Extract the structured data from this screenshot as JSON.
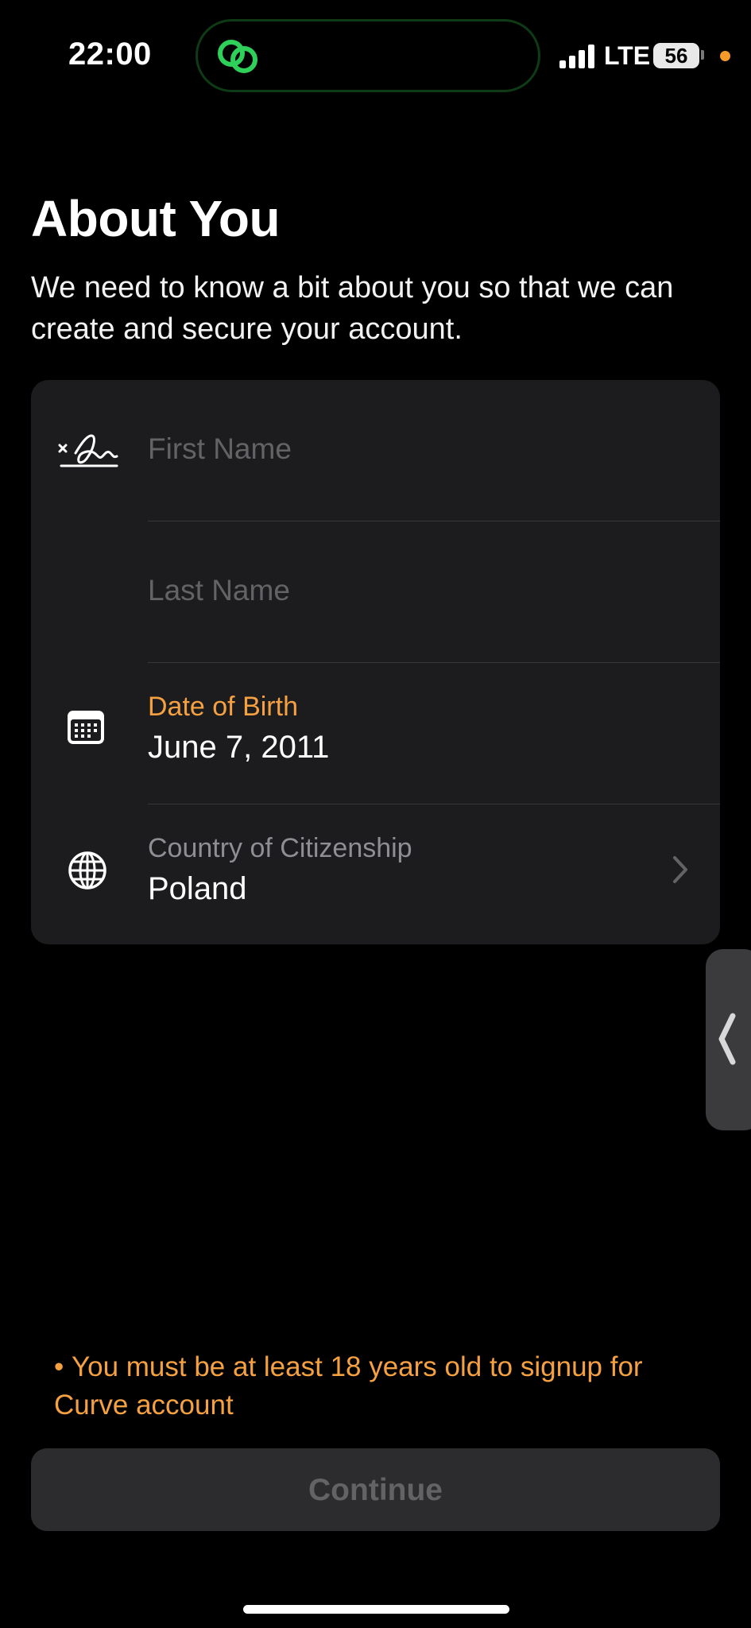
{
  "status_bar": {
    "time": "22:00",
    "network": "LTE",
    "battery": "56",
    "dynamic_island_icon": "linked-rings-icon",
    "accent_green": "#2fd05a",
    "privacy_dot": "#f39a2b"
  },
  "header": {
    "title": "About You",
    "subtitle": "We need to know a bit about you so that we can create and secure your account."
  },
  "form": {
    "first_name": {
      "placeholder": "First Name",
      "icon": "signature-icon"
    },
    "last_name": {
      "placeholder": "Last Name"
    },
    "date_of_birth": {
      "label": "Date of Birth",
      "value": "June 7, 2011",
      "icon": "calendar-icon",
      "label_color": "#f5a142"
    },
    "citizenship": {
      "label": "Country of Citizenship",
      "value": "Poland",
      "icon": "globe-icon"
    }
  },
  "warning": {
    "text": "You must be at least 18 years old to signup for Curve account",
    "color": "#f5a142"
  },
  "continue_button": {
    "label": "Continue",
    "enabled": false
  }
}
